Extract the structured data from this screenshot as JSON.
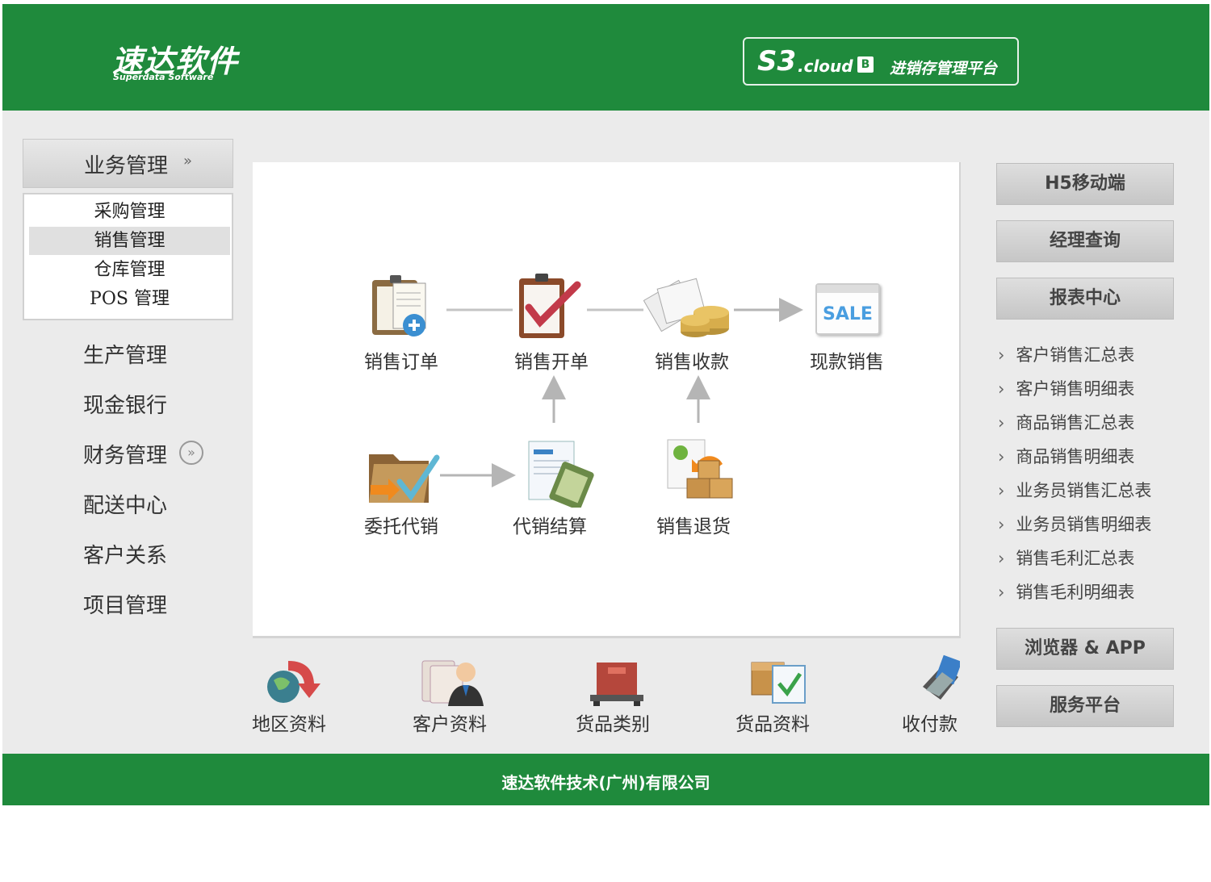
{
  "header": {
    "brand_name": "速达软件",
    "brand_sub": "Superdata Software",
    "product_code": "S3",
    "product_cloud": ".cloud",
    "product_badge": "B",
    "product_tag": "进销存管理平台"
  },
  "nav": {
    "head_label": "业务管理",
    "sub_items": [
      "采购管理",
      "销售管理",
      "仓库管理",
      "POS 管理"
    ],
    "active_sub": "销售管理",
    "main_items": [
      "生产管理",
      "现金银行",
      "财务管理",
      "配送中心",
      "客户关系",
      "项目管理"
    ]
  },
  "workflow": {
    "items": [
      "销售订单",
      "销售开单",
      "销售收款",
      "现款销售",
      "委托代销",
      "代销结算",
      "销售退货"
    ],
    "sale_badge": "SALE"
  },
  "quick": {
    "items": [
      "地区资料",
      "客户资料",
      "货品类别",
      "货品资料",
      "收付款"
    ]
  },
  "right": {
    "buttons_top": [
      "H5移动端",
      "经理查询",
      "报表中心"
    ],
    "reports": [
      "客户销售汇总表",
      "客户销售明细表",
      "商品销售汇总表",
      "商品销售明细表",
      "业务员销售汇总表",
      "业务员销售明细表",
      "销售毛利汇总表",
      "销售毛利明细表"
    ],
    "buttons_bottom": [
      "浏览器 & APP",
      "服务平台"
    ]
  },
  "footer": {
    "text": "速达软件技术(广州)有限公司"
  },
  "colors": {
    "brand_green": "#1f8a3c",
    "panel_bg": "#ebebeb"
  }
}
